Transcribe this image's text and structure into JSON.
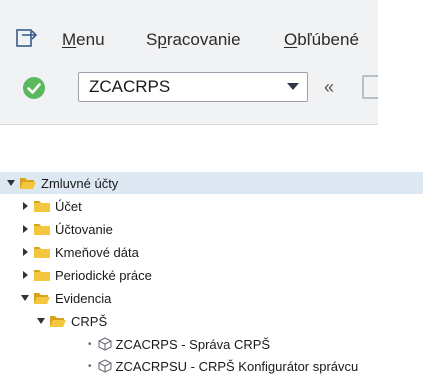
{
  "menubar": {
    "items": [
      {
        "label": "Menu",
        "accel_index": 0
      },
      {
        "label": "Spracovanie",
        "accel_index": 1
      },
      {
        "label": "Obľúbené",
        "accel_index": 0
      }
    ]
  },
  "command_bar": {
    "transaction_code": "ZCACRPS",
    "collapse_symbol": "«"
  },
  "tree": {
    "root": {
      "label": "Zmluvné účty",
      "expanded": true
    },
    "children": [
      {
        "label": "Účet",
        "expanded": false
      },
      {
        "label": "Účtovanie",
        "expanded": false
      },
      {
        "label": "Kmeňové dáta",
        "expanded": false
      },
      {
        "label": "Periodické práce",
        "expanded": false
      },
      {
        "label": "Evidencia",
        "expanded": true
      }
    ],
    "evidencia_children": [
      {
        "label": "CRPŠ",
        "expanded": true
      }
    ],
    "crps_transactions": [
      {
        "label": "ZCACRPS - Správa CRPŠ"
      },
      {
        "label": "ZCACRPSU - CRPŠ Konfigurátor správcu"
      }
    ]
  },
  "colors": {
    "folder_yellow": "#f4c63d",
    "folder_dark": "#d9a21b",
    "ok_green": "#5cb85c",
    "toolbar_bg": "#f1f2f4",
    "selection_bg": "#dde8f3"
  }
}
